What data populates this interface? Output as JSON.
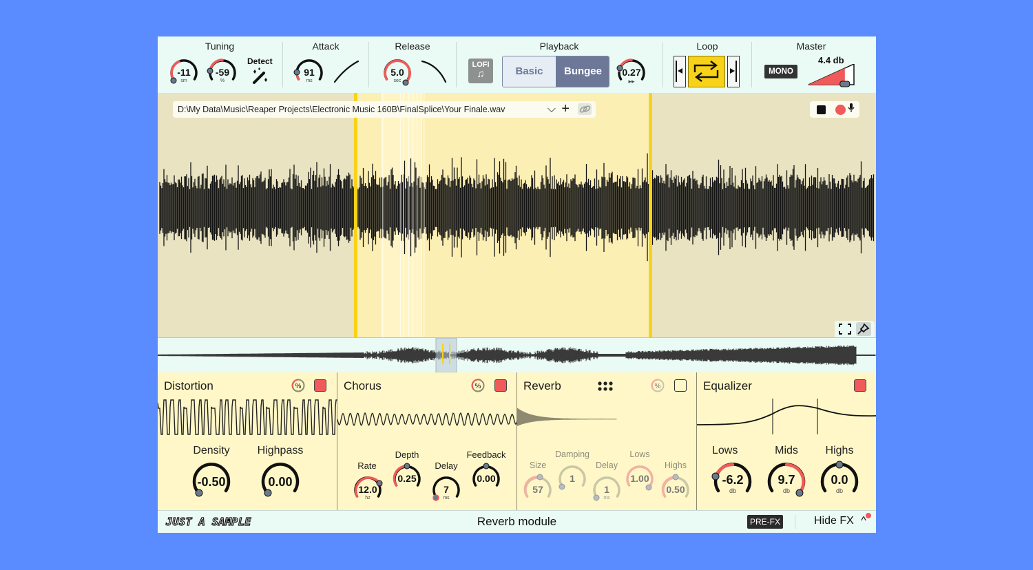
{
  "top": {
    "tuning": {
      "title": "Tuning",
      "semitones": "-11",
      "semitones_unit": "sm",
      "cents": "-59",
      "cents_unit": "%",
      "detect_label": "Detect"
    },
    "attack": {
      "title": "Attack",
      "value": "91",
      "unit": "ms"
    },
    "release": {
      "title": "Release",
      "value": "5.0",
      "unit": "sec"
    },
    "playback": {
      "title": "Playback",
      "lofi_label": "LOFI",
      "modes": [
        "Basic",
        "Bungee"
      ],
      "selected_mode": "Bungee",
      "speed": "0.27"
    },
    "loop": {
      "title": "Loop",
      "active": true
    },
    "master": {
      "title": "Master",
      "mono_label": "MONO",
      "gain": "4.4 db",
      "gain_fraction": 0.8
    }
  },
  "waveform": {
    "file_path": "D:\\My Data\\Music\\Reaper Projects\\Electronic Music 160B\\FinalSplice\\Your Finale.wav",
    "loop_region_color": "#fcefb4",
    "marker_color": "#f8d218"
  },
  "fx": {
    "distortion": {
      "title": "Distortion",
      "enabled": true,
      "density_label": "Density",
      "density": "-0.50",
      "highpass_label": "Highpass",
      "highpass": "0.00"
    },
    "chorus": {
      "title": "Chorus",
      "enabled": true,
      "rate_label": "Rate",
      "rate": "12.0",
      "rate_unit": "hz",
      "depth_label": "Depth",
      "depth": "0.25",
      "delay_label": "Delay",
      "delay": "7",
      "delay_unit": "ms",
      "feedback_label": "Feedback",
      "feedback": "0.00"
    },
    "reverb": {
      "title": "Reverb",
      "enabled": false,
      "size_label": "Size",
      "size": "57",
      "damping_label": "Damping",
      "damping": "1",
      "delay_label": "Delay",
      "delay": "1",
      "delay_unit": "ms",
      "lows_label": "Lows",
      "lows": "1.00",
      "highs_label": "Highs",
      "highs": "0.50"
    },
    "equalizer": {
      "title": "Equalizer",
      "enabled": true,
      "lows_label": "Lows",
      "lows": "-6.2",
      "lows_unit": "db",
      "mids_label": "Mids",
      "mids": "9.7",
      "mids_unit": "db",
      "highs_label": "Highs",
      "highs": "0.0",
      "highs_unit": "db"
    }
  },
  "bottom": {
    "brand": "JUST A SAMPLE",
    "status": "Reverb module",
    "prefx_label": "PRE-FX",
    "hidefx_label": "Hide FX"
  },
  "colors": {
    "accent_red": "#f05a5a",
    "loop_yellow": "#f8d218",
    "panel_bg": "#fff7c7",
    "mode_selected": "#6d7898",
    "mode_unselected": "#e6edf4"
  }
}
